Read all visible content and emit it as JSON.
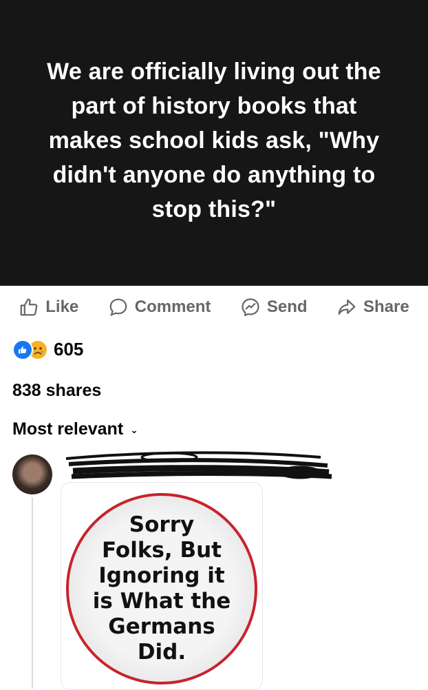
{
  "post": {
    "text": "We are officially living out the part of history books that makes school kids ask, \"Why didn't anyone do anything to stop this?\""
  },
  "actions": {
    "like": "Like",
    "comment": "Comment",
    "send": "Send",
    "share": "Share"
  },
  "reactions": {
    "count": "605",
    "types": [
      "like-icon",
      "sad-icon"
    ]
  },
  "shares": "838 shares",
  "comments": {
    "sort_label": "Most relevant",
    "first": {
      "image_text": "Sorry\nFolks, But\nIgnoring it\nis What the\nGermans\nDid."
    }
  },
  "colors": {
    "banner_bg": "#161616",
    "action_gray": "#65676b",
    "like_blue": "#1877f2",
    "sad_yellow": "#f7b125",
    "badge_red": "#c8232c"
  }
}
